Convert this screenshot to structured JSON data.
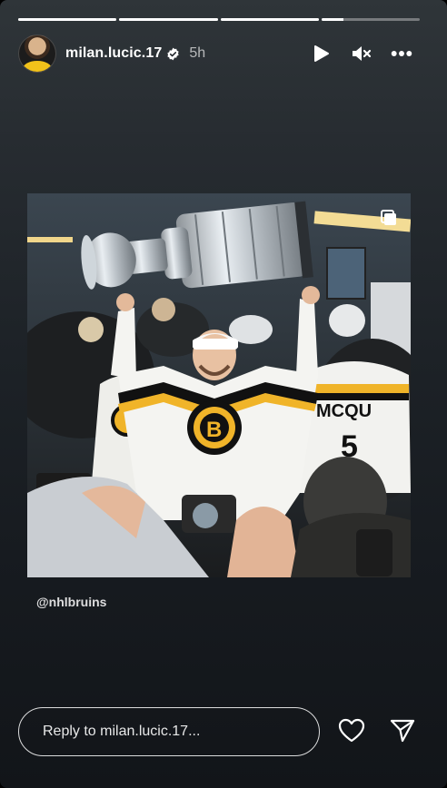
{
  "story": {
    "progress_segments": [
      1,
      1,
      1,
      0.22
    ],
    "colors": {
      "background_top": "#2f3539",
      "background_bottom": "#121519",
      "verified_badge": "#ffffff"
    }
  },
  "header": {
    "username": "milan.lucic.17",
    "time_ago": "5h",
    "avatar_icon": "profile-avatar",
    "verified_icon": "verified-badge-icon",
    "play_icon": "play-icon",
    "mute_icon": "muted-speaker-icon",
    "more_icon": "more-horizontal-icon"
  },
  "post": {
    "image_description_icon": "carousel-icon",
    "mention": "@nhlbruins"
  },
  "reply_bar": {
    "placeholder": "Reply to milan.lucic.17...",
    "like_icon": "heart-icon",
    "share_icon": "send-icon"
  }
}
